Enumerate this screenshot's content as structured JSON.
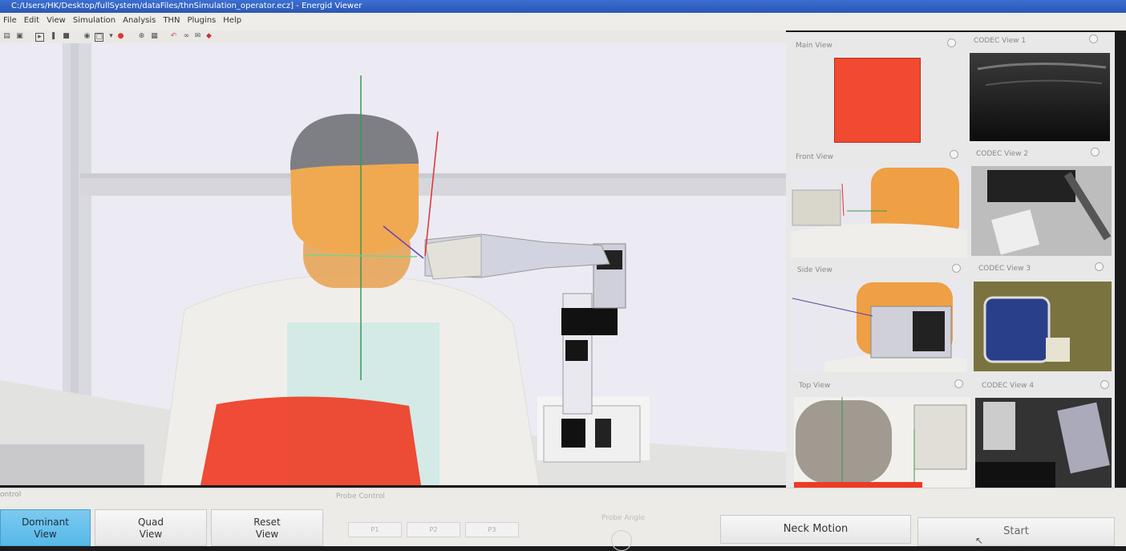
{
  "window": {
    "title": "C:/Users/HK/Desktop/fullSystem/dataFiles/thnSimulation_operator.ecz] - Energid Viewer"
  },
  "menu": {
    "items": [
      "File",
      "Edit",
      "View",
      "Simulation",
      "Analysis",
      "THN",
      "Plugins",
      "Help"
    ]
  },
  "views": {
    "main": "Main View",
    "front": "Front View",
    "side": "Side View",
    "top": "Top View",
    "codec1": "CODEC View 1",
    "codec2": "CODEC View 2",
    "codec3": "CODEC View 3",
    "codec4": "CODEC View 4"
  },
  "bottom": {
    "control_label": "ontrol",
    "probe_control_label": "Probe Control",
    "probe_angle_label": "Probe Angle",
    "dominant_line1": "Dominant",
    "dominant_line2": "View",
    "quad_line1": "Quad",
    "quad_line2": "View",
    "reset_line1": "Reset",
    "reset_line2": "View",
    "p1": "P1",
    "p2": "P2",
    "p3": "P3",
    "neck_motion": "Neck Motion",
    "start": "Start"
  },
  "colors": {
    "main_view_swatch": "#f04a30",
    "dominant_active": "#56b9e8",
    "titlebar": "#2a57b5"
  }
}
